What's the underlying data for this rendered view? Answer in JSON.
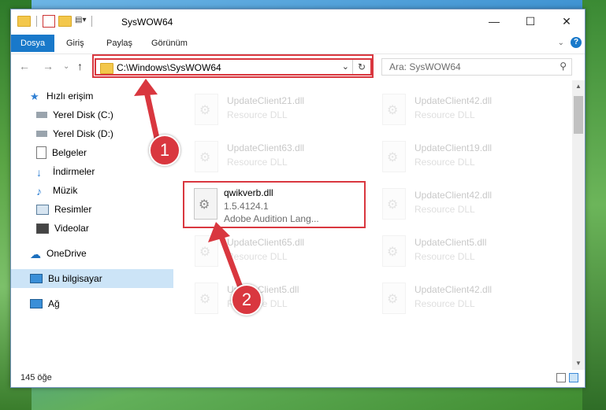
{
  "window": {
    "title": "SysWOW64"
  },
  "ribbon": {
    "tabs": [
      "Dosya",
      "Giriş",
      "Paylaş",
      "Görünüm"
    ]
  },
  "address": {
    "path": "C:\\Windows\\SysWOW64"
  },
  "search": {
    "placeholder": "Ara: SysWOW64"
  },
  "sidebar": {
    "items": [
      {
        "label": "Hızlı erişim",
        "icon": "star-icon"
      },
      {
        "label": "Yerel Disk (C:)",
        "icon": "drive-icon"
      },
      {
        "label": "Yerel Disk (D:)",
        "icon": "drive-icon"
      },
      {
        "label": "Belgeler",
        "icon": "document-icon"
      },
      {
        "label": "İndirmeler",
        "icon": "download-icon"
      },
      {
        "label": "Müzik",
        "icon": "music-icon"
      },
      {
        "label": "Resimler",
        "icon": "picture-icon"
      },
      {
        "label": "Videolar",
        "icon": "video-icon"
      },
      {
        "label": "OneDrive",
        "icon": "cloud-icon"
      },
      {
        "label": "Bu bilgisayar",
        "icon": "computer-icon"
      },
      {
        "label": "Ağ",
        "icon": "network-icon"
      }
    ]
  },
  "files": [
    {
      "name": "UpdateClient21.dll",
      "desc": "Resource DLL"
    },
    {
      "name": "UpdateClient42.dll",
      "desc": "Resource DLL"
    },
    {
      "name": "UpdateClient63.dll",
      "desc": "Resource DLL"
    },
    {
      "name": "UpdateClient19.dll",
      "desc": "Resource DLL"
    },
    {
      "name": "qwikverb.dll",
      "version": "1.5.4124.1",
      "desc": "Adobe Audition Lang..."
    },
    {
      "name": "UpdateClient42.dll",
      "desc": "Resource DLL"
    },
    {
      "name": "UpdateClient65.dll",
      "desc": "Resource DLL"
    },
    {
      "name": "UpdateClient5.dll",
      "desc": "Resource DLL"
    },
    {
      "name": "UpdateClient5.dll",
      "desc": "Resource DLL"
    },
    {
      "name": "UpdateClient42.dll",
      "desc": "Resource DLL"
    }
  ],
  "status": {
    "count": "145 öğe"
  },
  "annotations": {
    "step1": "1",
    "step2": "2"
  },
  "colors": {
    "accent": "#1979ca",
    "highlight": "#d9373f"
  }
}
